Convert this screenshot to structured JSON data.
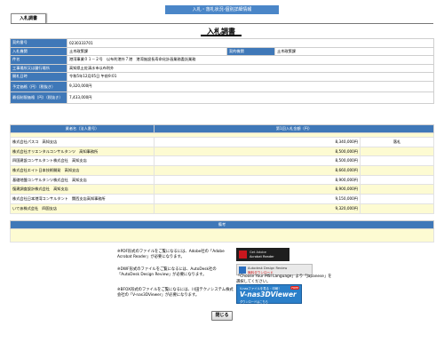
{
  "header": {
    "title": "入札・落札状況-個別詳細情報"
  },
  "tab": {
    "label": "入札調書"
  },
  "page_title": "入札調書",
  "info": {
    "contract_no_label": "契約番号",
    "contract_no": "0230333701",
    "bid_org_label": "入札機関",
    "bid_org": "土木政策課",
    "contract_org_label": "契約機関",
    "contract_org": "土木政策課",
    "subject_label": "件名",
    "subject": "港湾事業０１－２号　以布利港外７港　港湾施設長寿命化計画業務委託業務",
    "location_label": "工事場所又は履行場所",
    "location": "高知県土佐清水市以布利外",
    "opening_date_label": "開札日時",
    "opening_date": "令和5年12月05日 午前9:01",
    "estimated_price_label": "予定価格（円）（税抜き）",
    "estimated_price": "9,320,000円",
    "min_price_label": "最低制限価格（円）（税抜き）",
    "min_price": "7,433,000円"
  },
  "bids": {
    "col_name": "業者名（法人番号）",
    "col_amount": "第1回入札金額（円）",
    "rows": [
      {
        "name": "株式会社パスコ　高知支店",
        "amount": "8,340,000円",
        "note": "落札"
      },
      {
        "name": "株式会社オリエンタルコンサルタンツ　高知事務所",
        "amount": "8,500,000円",
        "note": ""
      },
      {
        "name": "四国建設コンサルタント株式会社　高知支店",
        "amount": "8,500,000円",
        "note": ""
      },
      {
        "name": "株式会社エイト日本技術開発　高知支店",
        "amount": "8,660,000円",
        "note": ""
      },
      {
        "name": "基礎地盤コンサルタンツ株式会社　高知支店",
        "amount": "8,900,000円",
        "note": ""
      },
      {
        "name": "復建調査設計株式会社　高知支店",
        "amount": "8,900,000円",
        "note": ""
      },
      {
        "name": "株式会社日本港湾コンサルタント　関西支店高知事務所",
        "amount": "9,150,000円",
        "note": ""
      },
      {
        "name": "いであ株式会社　四国支店",
        "amount": "9,320,000円",
        "note": ""
      }
    ]
  },
  "remarks": {
    "label": "備考",
    "value": ""
  },
  "notices": {
    "pdf": "※PDF形式のファイルをご覧になるには、Adobe社の「Adobe Acrobat Reader」が必要になります。",
    "dwf_1": "※DWF形式のファイルをご覧になるには、AutoDesk社の「AutoDesk Design Review」が必要になります。",
    "dwf_2": "「Choose Your MSI Language」より「Japanese」を選択してください。",
    "bfox": "※BFOX形式のファイルをご覧になるには、川田テクノシステム株式会社の「V-nas3DViewer」が必要になります。"
  },
  "banners": {
    "adobe_1": "Get Adobe",
    "adobe_2": "Acrobat Reader",
    "autodesk_1": "Autodesk Design Review",
    "autodesk_2": "無料ダウンロード",
    "vnas_1": "V-nasファイルを見る・印刷！",
    "vnas_badge": "FREE",
    "vnas_2": "V-nas3DViewer",
    "vnas_3": "ダウンロードはこちら"
  },
  "close_label": "閉じる",
  "colors": {
    "header_blue": "#3f78b8",
    "row_yellow": "#fdfbd2"
  }
}
